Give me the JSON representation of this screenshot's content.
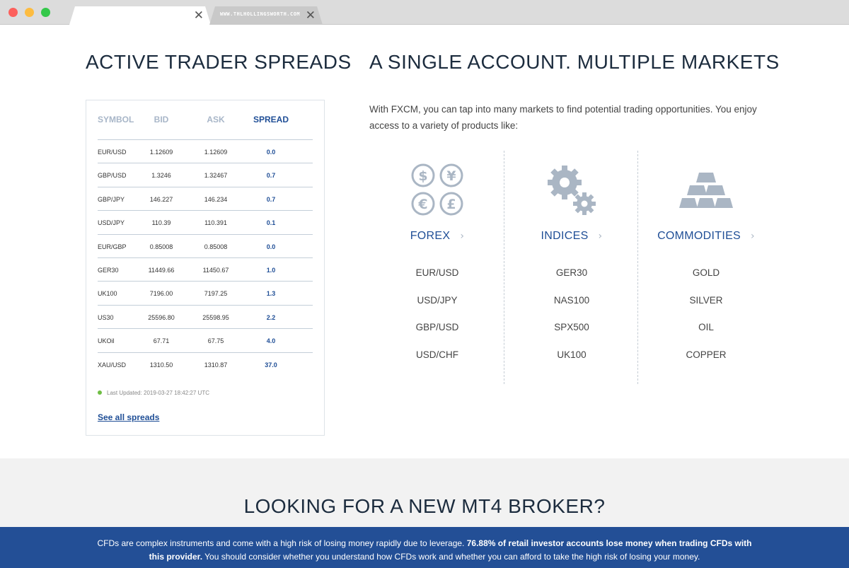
{
  "browser": {
    "url": "WWW.THLHOLLINGSWORTH.COM"
  },
  "spreads": {
    "title": "ACTIVE TRADER SPREADS",
    "headers": {
      "symbol": "SYMBOL",
      "bid": "BID",
      "ask": "ASK",
      "spread": "SPREAD"
    },
    "rows": [
      {
        "symbol": "EUR/USD",
        "bid": "1.12609",
        "ask": "1.12609",
        "spread": "0.0"
      },
      {
        "symbol": "GBP/USD",
        "bid": "1.3246",
        "ask": "1.32467",
        "spread": "0.7"
      },
      {
        "symbol": "GBP/JPY",
        "bid": "146.227",
        "ask": "146.234",
        "spread": "0.7"
      },
      {
        "symbol": "USD/JPY",
        "bid": "110.39",
        "ask": "110.391",
        "spread": "0.1"
      },
      {
        "symbol": "EUR/GBP",
        "bid": "0.85008",
        "ask": "0.85008",
        "spread": "0.0"
      },
      {
        "symbol": "GER30",
        "bid": "11449.66",
        "ask": "11450.67",
        "spread": "1.0"
      },
      {
        "symbol": "UK100",
        "bid": "7196.00",
        "ask": "7197.25",
        "spread": "1.3"
      },
      {
        "symbol": "US30",
        "bid": "25596.80",
        "ask": "25598.95",
        "spread": "2.2"
      },
      {
        "symbol": "UKOil",
        "bid": "67.71",
        "ask": "67.75",
        "spread": "4.0"
      },
      {
        "symbol": "XAU/USD",
        "bid": "1310.50",
        "ask": "1310.87",
        "spread": "37.0"
      }
    ],
    "last_updated": "Last Updated: 2019-03-27 18:42:27 UTC",
    "see_all": "See all spreads"
  },
  "markets_section": {
    "title": "A SINGLE ACCOUNT. MULTIPLE MARKETS",
    "description": "With FXCM, you can tap into many markets to find potential trading opportunities. You enjoy access to a variety of products like:",
    "markets": [
      {
        "name": "FOREX",
        "icon": "currency-coins-icon",
        "items": [
          "EUR/USD",
          "USD/JPY",
          "GBP/USD",
          "USD/CHF"
        ]
      },
      {
        "name": "INDICES",
        "icon": "gears-icon",
        "items": [
          "GER30",
          "NAS100",
          "SPX500",
          "UK100"
        ]
      },
      {
        "name": "COMMODITIES",
        "icon": "gold-bars-icon",
        "items": [
          "GOLD",
          "SILVER",
          "OIL",
          "COPPER"
        ]
      }
    ]
  },
  "bottom": {
    "title": "LOOKING FOR A NEW MT4 BROKER?"
  },
  "risk_warning": {
    "part1": "CFDs are complex instruments and come with a high risk of losing money rapidly due to leverage. ",
    "bold": "76.88% of retail investor accounts lose money when trading CFDs with this provider.",
    "part2": " You should consider whether you understand how CFDs work and whether you can afford to take the high risk of losing your money."
  },
  "colors": {
    "brand_blue": "#1f4e96",
    "icon_gray": "#aab6c4",
    "risk_banner": "#234f96",
    "updated_dot": "#6fbe44"
  }
}
